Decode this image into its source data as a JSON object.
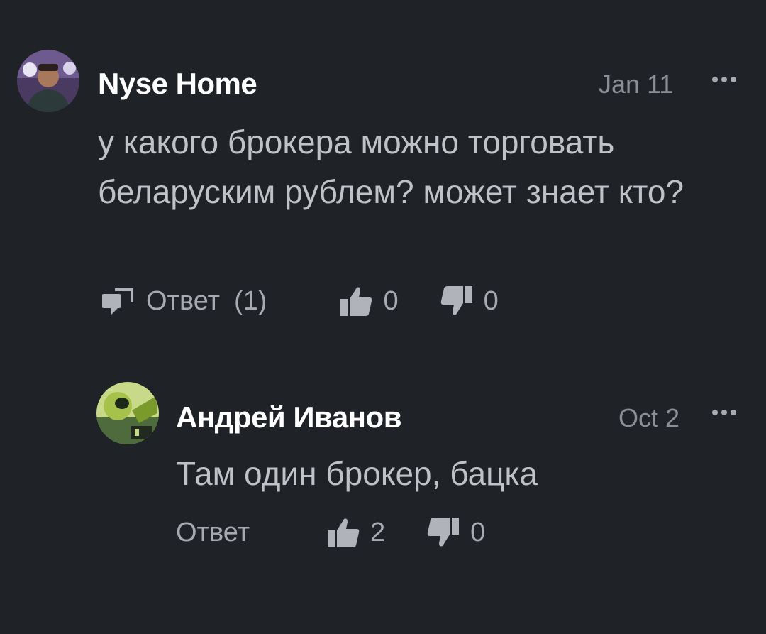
{
  "comments": [
    {
      "author": "Nyse Home",
      "date": "Jan 11",
      "text": "у какого брокера можно торговать беларуским рублем? может знает кто?",
      "reply_label": "Ответ",
      "reply_count": "(1)",
      "likes": "0",
      "dislikes": "0"
    },
    {
      "author": "Андрей Иванов",
      "date": "Oct 2",
      "text": "Там один брокер, бацка",
      "reply_label": "Ответ",
      "likes": "2",
      "dislikes": "0"
    }
  ],
  "colors": {
    "background": "#1f2227",
    "author": "#ffffff",
    "text": "#bfc3c8",
    "meta": "#8b8f95"
  },
  "icons": [
    "reply-icon",
    "thumbs-up-icon",
    "thumbs-down-icon",
    "more-icon"
  ]
}
